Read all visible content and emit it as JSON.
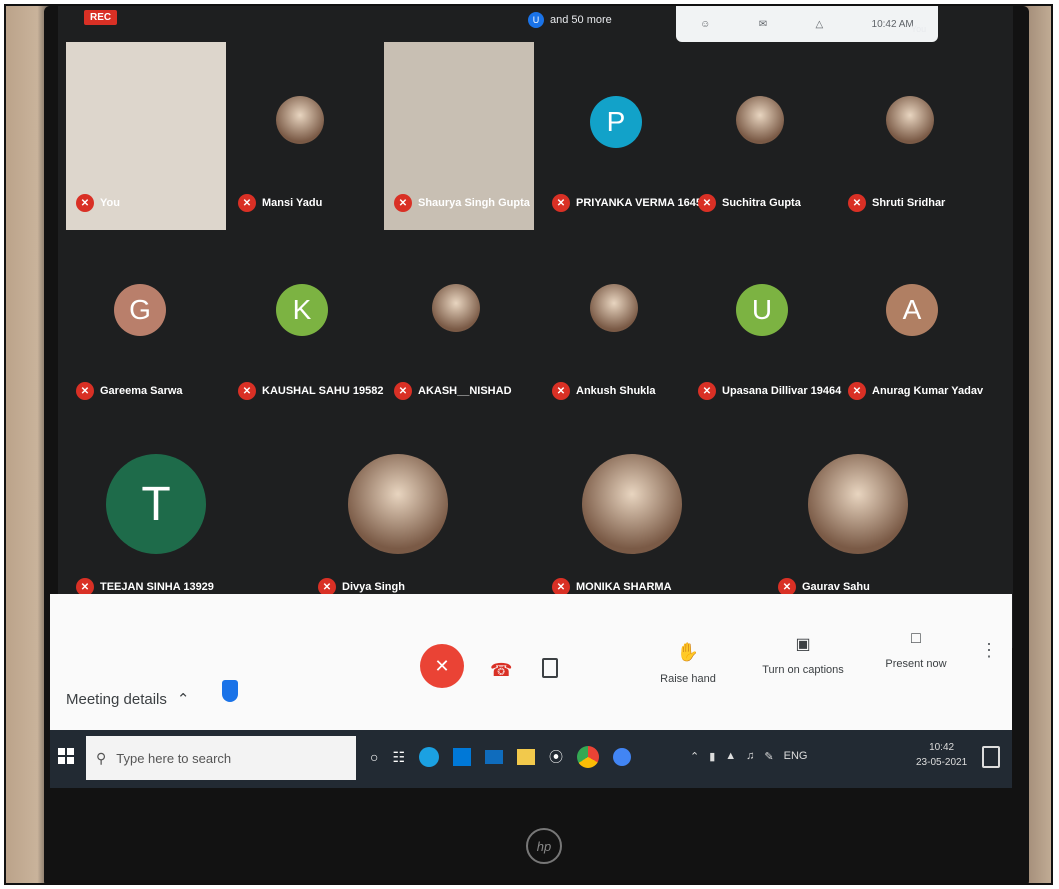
{
  "meeting": {
    "rec_label": "REC",
    "more_label": "and 50 more",
    "more_dot": "U",
    "clock_partial": "10:42 AM",
    "you_short": "You"
  },
  "participants": [
    {
      "name": "You",
      "type": "video"
    },
    {
      "name": "Mansi Yadu",
      "type": "photo"
    },
    {
      "name": "Shaurya Singh Gupta",
      "type": "video"
    },
    {
      "name": "PRIYANKA VERMA 16459",
      "type": "letter",
      "letter": "P",
      "color": "#12a2c9"
    },
    {
      "name": "Suchitra Gupta",
      "type": "photo"
    },
    {
      "name": "Shruti Sridhar",
      "type": "photo"
    },
    {
      "name": "Gareema Sarwa",
      "type": "letter",
      "letter": "G",
      "color": "#b97f6b"
    },
    {
      "name": "KAUSHAL SAHU 19582",
      "type": "letter",
      "letter": "K",
      "color": "#7cb342"
    },
    {
      "name": "AKASH__NISHAD",
      "type": "photo"
    },
    {
      "name": "Ankush Shukla",
      "type": "photo"
    },
    {
      "name": "Upasana Dillivar 19464",
      "type": "letter",
      "letter": "U",
      "color": "#7cb342"
    },
    {
      "name": "Anurag Kumar Yadav",
      "type": "letter",
      "letter": "A",
      "color": "#b07f63"
    },
    {
      "name": "TEEJAN SINHA 13929",
      "type": "letter",
      "letter": "T",
      "color": "#1e6b4a"
    },
    {
      "name": "Divya Singh",
      "type": "photo"
    },
    {
      "name": "MONIKA SHARMA",
      "type": "photo"
    },
    {
      "name": "Gaurav Sahu",
      "type": "photo"
    }
  ],
  "controls": {
    "meeting_details": "Meeting details",
    "raise_hand": "Raise hand",
    "captions": "Turn on captions",
    "present": "Present now"
  },
  "taskbar": {
    "search_placeholder": "Type here to search",
    "time": "10:42",
    "date": "23-05-2021",
    "lang": "ENG"
  },
  "hp_logo": "hp"
}
